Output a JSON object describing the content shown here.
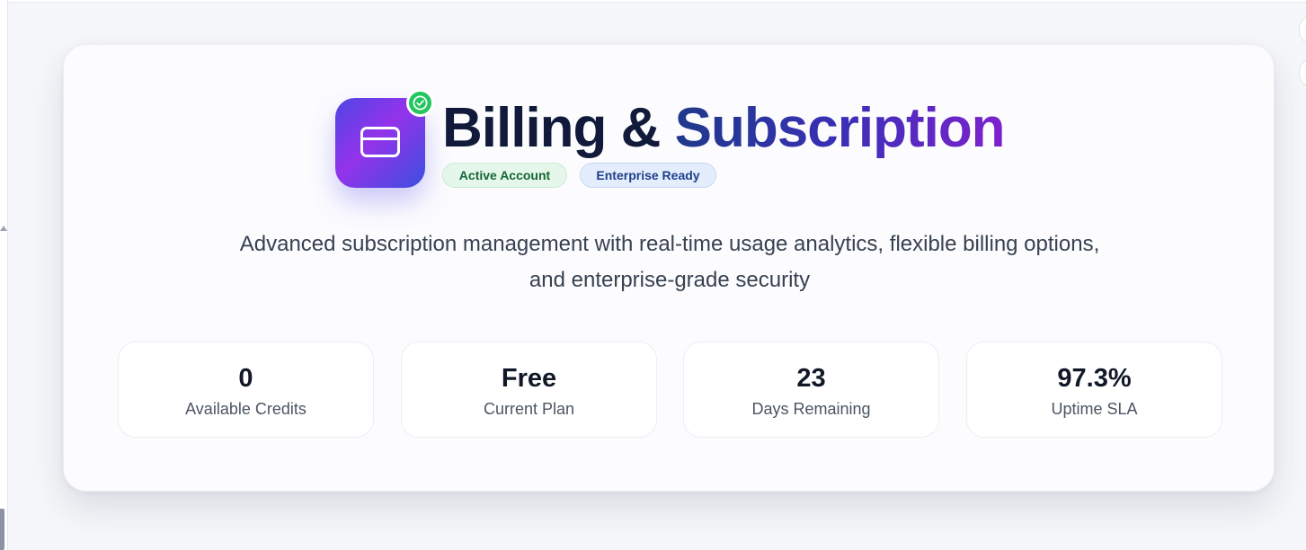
{
  "header": {
    "title_part1": "Billing &",
    "title_part2": "Subscription",
    "logo_icon": "credit-card-icon",
    "verified_icon": "check-circle-icon",
    "badges": [
      {
        "label": "Active Account",
        "color": "#166534"
      },
      {
        "label": "Enterprise Ready",
        "color": "#1e3f8a"
      }
    ]
  },
  "description_line1": "Advanced subscription management with real-time usage analytics, flexible billing options,",
  "description_line2": "and enterprise-grade security",
  "stats": [
    {
      "value": "0",
      "label": "Available Credits"
    },
    {
      "value": "Free",
      "label": "Current Plan"
    },
    {
      "value": "23",
      "label": "Days Remaining"
    },
    {
      "value": "97.3%",
      "label": "Uptime SLA"
    }
  ],
  "colors": {
    "accent_start": "#4f46e5",
    "accent_end": "#9333ea",
    "success": "#22c55e"
  }
}
